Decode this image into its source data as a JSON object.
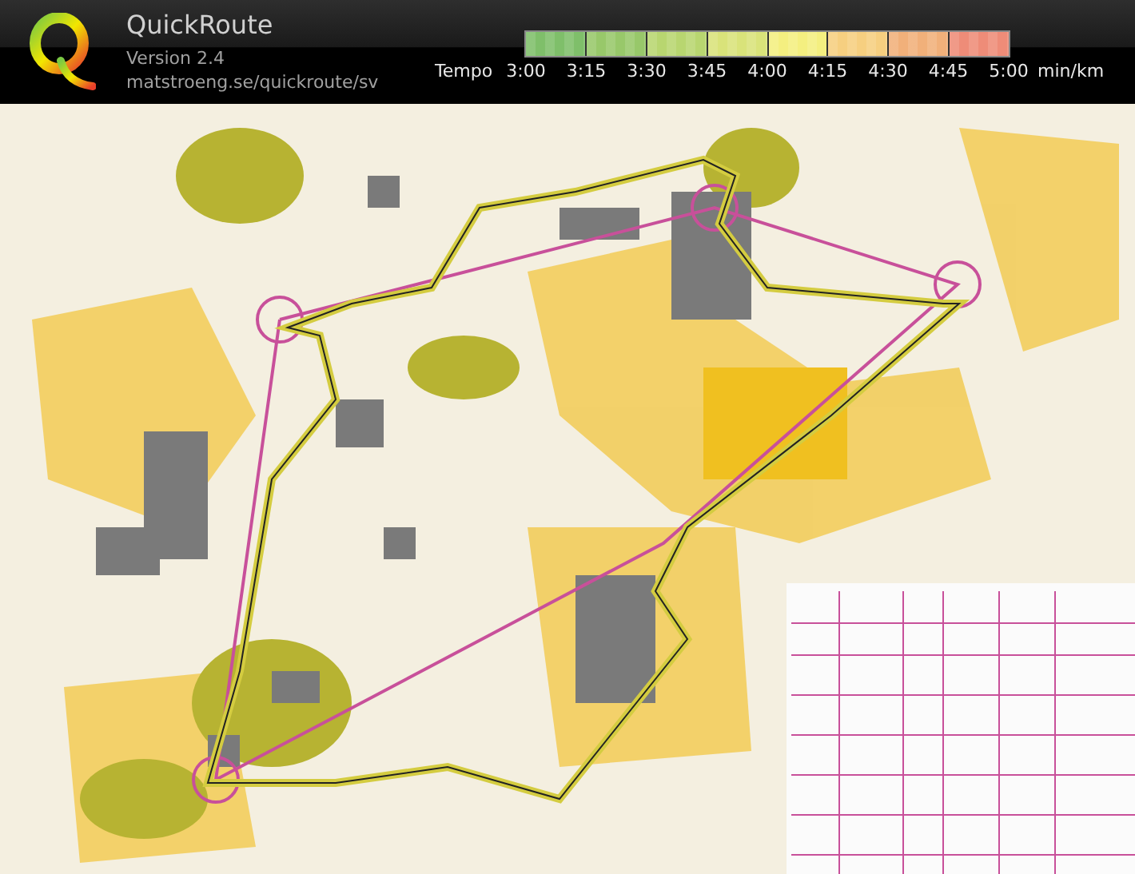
{
  "header": {
    "title": "QuickRoute",
    "version": "Version 2.4",
    "url": "matstroeng.se/quickroute/sv"
  },
  "pace_scale": {
    "label": "Tempo",
    "ticks": [
      "3:00",
      "3:15",
      "3:30",
      "3:45",
      "4:00",
      "4:15",
      "4:30",
      "4:45",
      "5:00"
    ],
    "unit": "min/km"
  }
}
